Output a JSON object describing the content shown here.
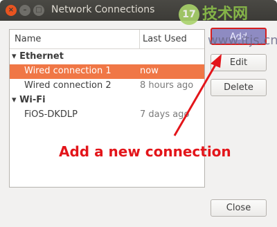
{
  "window": {
    "title": "Network Connections"
  },
  "list": {
    "columns": {
      "name": "Name",
      "last_used": "Last Used"
    },
    "groups": [
      {
        "label": "Ethernet",
        "items": [
          {
            "name": "Wired connection 1",
            "last_used": "now",
            "selected": true
          },
          {
            "name": "Wired connection 2",
            "last_used": "8 hours ago",
            "selected": false
          }
        ]
      },
      {
        "label": "Wi-Fi",
        "items": [
          {
            "name": "FiOS-DKDLP",
            "last_used": "7 days ago",
            "selected": false
          }
        ]
      }
    ]
  },
  "buttons": {
    "add": "Add",
    "edit": "Edit",
    "delete": "Delete",
    "close": "Close"
  },
  "annotation": {
    "text": "Add a new connection",
    "color": "#e3151a"
  },
  "watermark": {
    "logo": "17",
    "text": "技术网",
    "url": "www.itjs.cn"
  },
  "colors": {
    "selection": "#f07746",
    "titlebar": "#3c3b37",
    "close_button": "#e95420"
  }
}
